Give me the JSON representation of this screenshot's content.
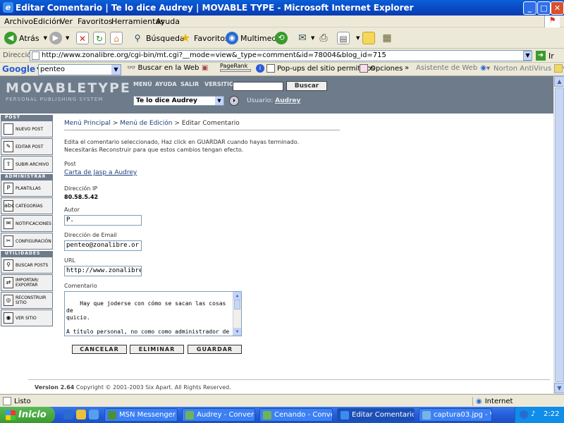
{
  "window": {
    "title": "Editar Comentario | Te lo dice Audrey | MOVABLE TYPE - Microsoft Internet Explorer"
  },
  "menu": [
    "Archivo",
    "Edición",
    "Ver",
    "Favoritos",
    "Herramientas",
    "Ayuda"
  ],
  "toolbar": {
    "back": "Atrás",
    "search": "Búsqueda",
    "favorites": "Favoritos",
    "media": "Multimedia"
  },
  "address": {
    "label": "Dirección",
    "url": "http://www.zonalibre.org/cgi-bin/mt.cgi?__mode=view&_type=comment&id=78004&blog_id=715",
    "go": "Ir"
  },
  "google": {
    "logo": "Google",
    "query": "penteo",
    "search_web": "Buscar en la Web",
    "pagerank": "PageRank",
    "popups": "Pop-ups del sitio permitidos",
    "options": "Opciones",
    "web_assistant": "Asistente de Web",
    "antivirus": "Norton AntiVirus"
  },
  "mt": {
    "logo": "MOVABLETYPE",
    "logo_sub": "PERSONAL PUBLISHING SYSTEM",
    "nav": [
      "MENÚ",
      "AYUDA",
      "SALIR",
      "VERSITIO"
    ],
    "search_btn": "Buscar",
    "blog_select": "Te lo dice Audrey",
    "user_label": "Usuario:",
    "user": "Audrey"
  },
  "sidebar": {
    "sections": [
      {
        "title": "POST",
        "items": [
          "NUEVO POST",
          "EDITAR POST",
          "SUBIR ARCHIVO"
        ]
      },
      {
        "title": "ADMINISTRAR",
        "items": [
          "PLANTILLAS",
          "CATEGORÍAS",
          "NOTIFICACIONES",
          "CONFIGURACIÓN"
        ]
      },
      {
        "title": "UTILIDADES",
        "items": [
          "BUSCAR POSTS",
          "IMPORTAR/ EXPORTAR",
          "RECONSTRUIR SITIO",
          "VER SITIO"
        ]
      }
    ]
  },
  "content": {
    "breadcrumb": [
      "Menú Principal",
      "Menú de Edición",
      "Editar Comentario"
    ],
    "intro": "Edita el comentario seleccionado, Haz click en GUARDAR cuando hayas terminado. Necesitarás Reconstruir para que estos cambios tengan efecto.",
    "post_label": "Post",
    "post_link": "Carta de Jasp a Audrey",
    "ip_label": "Dirección IP",
    "ip": "80.58.5.42",
    "author_label": "Autor",
    "author": "P.",
    "email_label": "Dirección de Email",
    "email": "penteo@zonalibre.or",
    "url_label": "URL",
    "url": "http://www.zonalibre",
    "comment_label": "Comentario",
    "comment": "Hay que joderse con cómo se sacan las cosas de\nquicio.\n\nA título personal, no como como administrador de\nZL, decir que me parece completamente\ninnecesario seguir dándole vueltas al tema,",
    "buttons": {
      "cancel": "CANCELAR",
      "delete": "ELIMINAR",
      "save": "GUARDAR"
    },
    "footer_version": "Version 2.64",
    "footer_copy": "Copyright © 2001-2003 Six Apart. All Rights Reserved."
  },
  "statusbar": {
    "text": "Listo",
    "zone": "Internet"
  },
  "taskbar": {
    "start": "Inicio",
    "buttons": [
      "MSN Messenger",
      "Audrey - Convers...",
      "Cenando - Conver...",
      "Editar Comentario...",
      "captura03.jpg - Vi..."
    ],
    "clock": "2:22"
  }
}
